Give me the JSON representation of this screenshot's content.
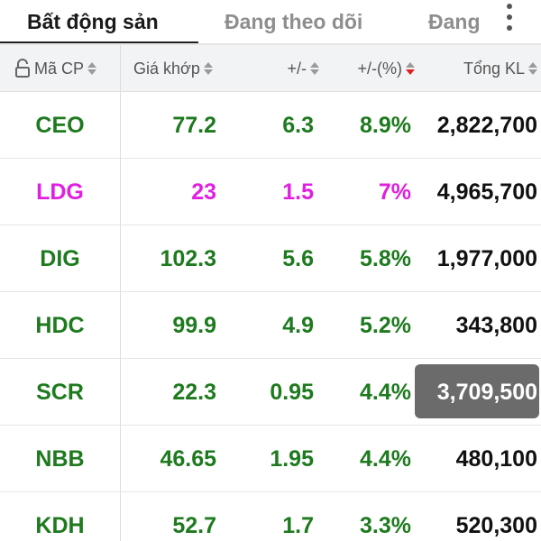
{
  "tabs": [
    {
      "label": "Bất động sản",
      "active": true
    },
    {
      "label": "Đang theo dõi",
      "active": false
    },
    {
      "label": "Đang",
      "active": false
    }
  ],
  "header": {
    "symbol": "Mã CP",
    "price": "Giá khớp",
    "change": "+/-",
    "change_pct": "+/-(%)",
    "volume": "Tổng KL"
  },
  "colors": {
    "up": "#1e7a1e",
    "ceiling": "#e020e0",
    "volume": "#111111",
    "highlight_bg": "#6b6b6b"
  },
  "rows": [
    {
      "symbol": "CEO",
      "price": "77.2",
      "change": "6.3",
      "change_pct": "8.9%",
      "volume": "2,822,700",
      "color": "#1e7a1e",
      "highlight": false
    },
    {
      "symbol": "LDG",
      "price": "23",
      "change": "1.5",
      "change_pct": "7%",
      "volume": "4,965,700",
      "color": "#e020e0",
      "highlight": false
    },
    {
      "symbol": "DIG",
      "price": "102.3",
      "change": "5.6",
      "change_pct": "5.8%",
      "volume": "1,977,000",
      "color": "#1e7a1e",
      "highlight": false
    },
    {
      "symbol": "HDC",
      "price": "99.9",
      "change": "4.9",
      "change_pct": "5.2%",
      "volume": "343,800",
      "color": "#1e7a1e",
      "highlight": false
    },
    {
      "symbol": "SCR",
      "price": "22.3",
      "change": "0.95",
      "change_pct": "4.4%",
      "volume": "3,709,500",
      "color": "#1e7a1e",
      "highlight": true
    },
    {
      "symbol": "NBB",
      "price": "46.65",
      "change": "1.95",
      "change_pct": "4.4%",
      "volume": "480,100",
      "color": "#1e7a1e",
      "highlight": false
    },
    {
      "symbol": "KDH",
      "price": "52.7",
      "change": "1.7",
      "change_pct": "3.3%",
      "volume": "520,300",
      "color": "#1e7a1e",
      "highlight": false
    }
  ]
}
